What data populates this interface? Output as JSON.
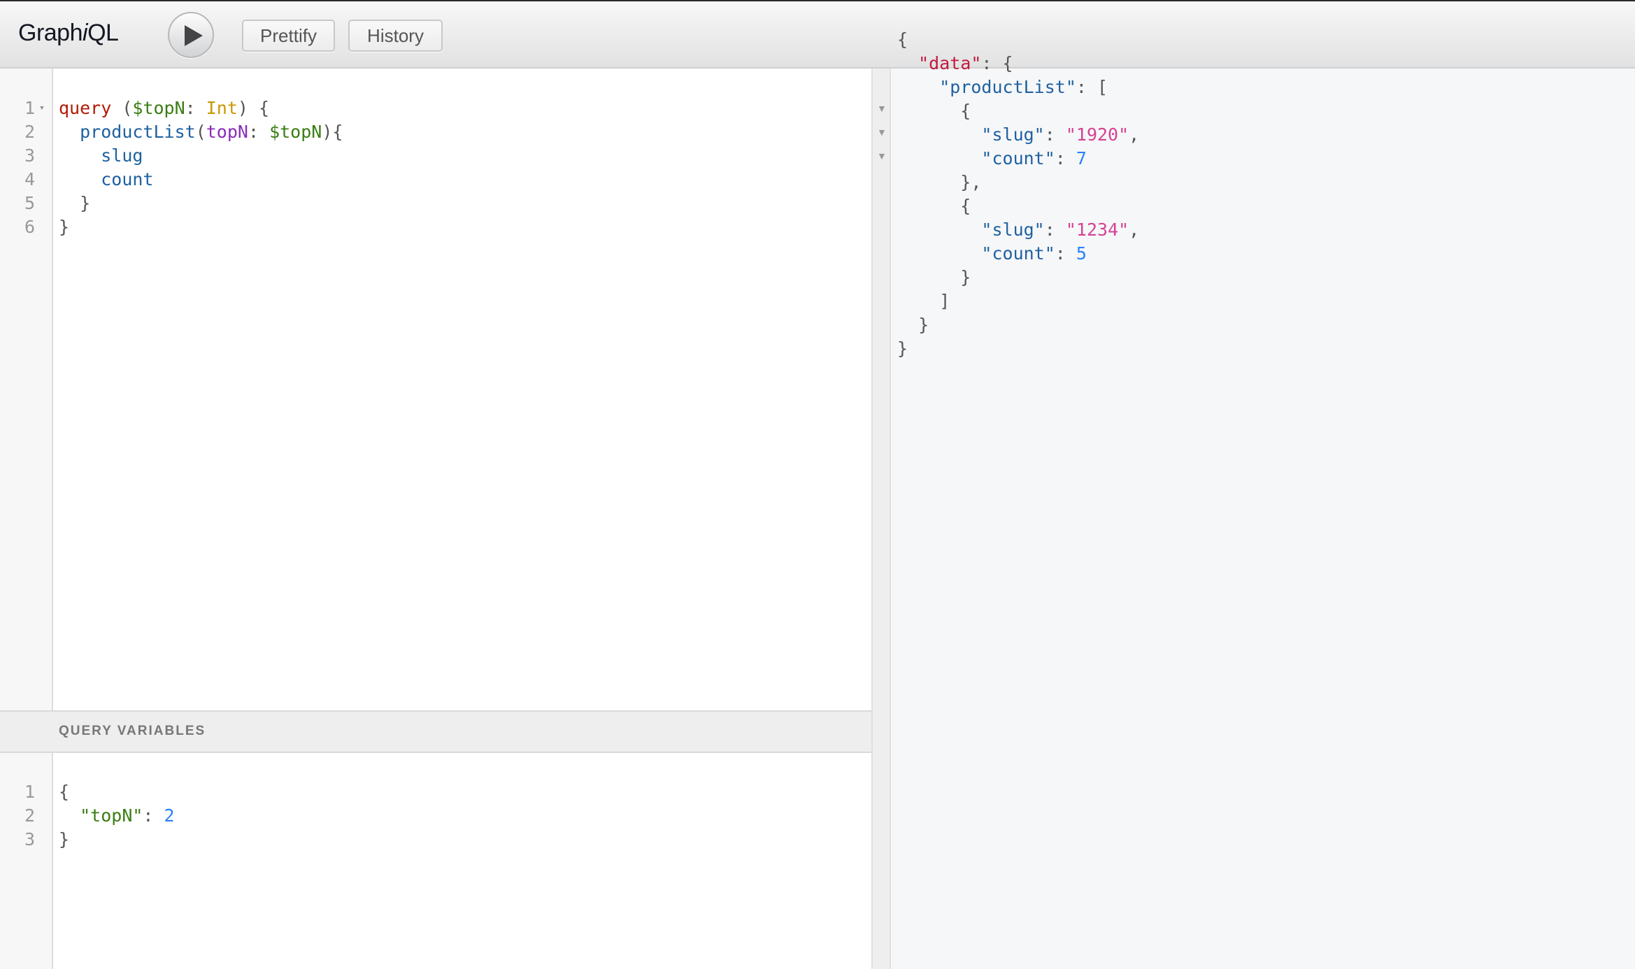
{
  "app": {
    "title_prefix": "Graph",
    "title_italic": "i",
    "title_suffix": "QL"
  },
  "toolbar": {
    "execute_icon": "play-icon",
    "prettify_label": "Prettify",
    "history_label": "History"
  },
  "query_editor": {
    "line_numbers": [
      "1",
      "2",
      "3",
      "4",
      "5",
      "6"
    ],
    "fold_icon": "▾",
    "lines": [
      [
        {
          "t": "query",
          "c": "kw"
        },
        {
          "t": " (",
          "c": "punct"
        },
        {
          "t": "$topN",
          "c": "var"
        },
        {
          "t": ": ",
          "c": "punct"
        },
        {
          "t": "Int",
          "c": "type"
        },
        {
          "t": ") {",
          "c": "punct"
        }
      ],
      [
        {
          "t": "  ",
          "c": "punct"
        },
        {
          "t": "productList",
          "c": "field"
        },
        {
          "t": "(",
          "c": "punct"
        },
        {
          "t": "topN",
          "c": "arg"
        },
        {
          "t": ": ",
          "c": "punct"
        },
        {
          "t": "$topN",
          "c": "var"
        },
        {
          "t": "){",
          "c": "punct"
        }
      ],
      [
        {
          "t": "    ",
          "c": "punct"
        },
        {
          "t": "slug",
          "c": "field"
        }
      ],
      [
        {
          "t": "    ",
          "c": "punct"
        },
        {
          "t": "count",
          "c": "field"
        }
      ],
      [
        {
          "t": "  }",
          "c": "punct"
        }
      ],
      [
        {
          "t": "}",
          "c": "punct"
        }
      ]
    ]
  },
  "variables": {
    "header": "QUERY VARIABLES",
    "line_numbers": [
      "1",
      "2",
      "3"
    ],
    "lines": [
      [
        {
          "t": "{",
          "c": "punct"
        }
      ],
      [
        {
          "t": "  ",
          "c": "punct"
        },
        {
          "t": "\"topN\"",
          "c": "vkey"
        },
        {
          "t": ": ",
          "c": "punct"
        },
        {
          "t": "2",
          "c": "jnum"
        }
      ],
      [
        {
          "t": "}",
          "c": "punct"
        }
      ]
    ]
  },
  "result": {
    "fold_lines": [
      0,
      1,
      2
    ],
    "fold_icon": "▼",
    "lines": [
      [
        {
          "t": "{",
          "c": "punct"
        }
      ],
      [
        {
          "t": "  ",
          "c": "punct"
        },
        {
          "t": "\"data\"",
          "c": "jkey-data"
        },
        {
          "t": ": {",
          "c": "punct"
        }
      ],
      [
        {
          "t": "    ",
          "c": "punct"
        },
        {
          "t": "\"productList\"",
          "c": "jkey"
        },
        {
          "t": ": [",
          "c": "punct"
        }
      ],
      [
        {
          "t": "      {",
          "c": "punct"
        }
      ],
      [
        {
          "t": "        ",
          "c": "punct"
        },
        {
          "t": "\"slug\"",
          "c": "jkey"
        },
        {
          "t": ": ",
          "c": "punct"
        },
        {
          "t": "\"1920\"",
          "c": "jstr"
        },
        {
          "t": ",",
          "c": "punct"
        }
      ],
      [
        {
          "t": "        ",
          "c": "punct"
        },
        {
          "t": "\"count\"",
          "c": "jkey"
        },
        {
          "t": ": ",
          "c": "punct"
        },
        {
          "t": "7",
          "c": "jnum"
        }
      ],
      [
        {
          "t": "      },",
          "c": "punct"
        }
      ],
      [
        {
          "t": "      {",
          "c": "punct"
        }
      ],
      [
        {
          "t": "        ",
          "c": "punct"
        },
        {
          "t": "\"slug\"",
          "c": "jkey"
        },
        {
          "t": ": ",
          "c": "punct"
        },
        {
          "t": "\"1234\"",
          "c": "jstr"
        },
        {
          "t": ",",
          "c": "punct"
        }
      ],
      [
        {
          "t": "        ",
          "c": "punct"
        },
        {
          "t": "\"count\"",
          "c": "jkey"
        },
        {
          "t": ": ",
          "c": "punct"
        },
        {
          "t": "5",
          "c": "jnum"
        }
      ],
      [
        {
          "t": "      }",
          "c": "punct"
        }
      ],
      [
        {
          "t": "    ]",
          "c": "punct"
        }
      ],
      [
        {
          "t": "  }",
          "c": "punct"
        }
      ],
      [
        {
          "t": "}",
          "c": "punct"
        }
      ]
    ],
    "data": {
      "productList": [
        {
          "slug": "1920",
          "count": 7
        },
        {
          "slug": "1234",
          "count": 5
        }
      ]
    }
  },
  "colors": {
    "keyword": "#b11a04",
    "variable": "#397d13",
    "type": "#ca9800",
    "field": "#1f61a0",
    "argument": "#8b2bb9",
    "string": "#d64292",
    "number": "#2882f9",
    "result_data_key": "#c41a3f"
  }
}
